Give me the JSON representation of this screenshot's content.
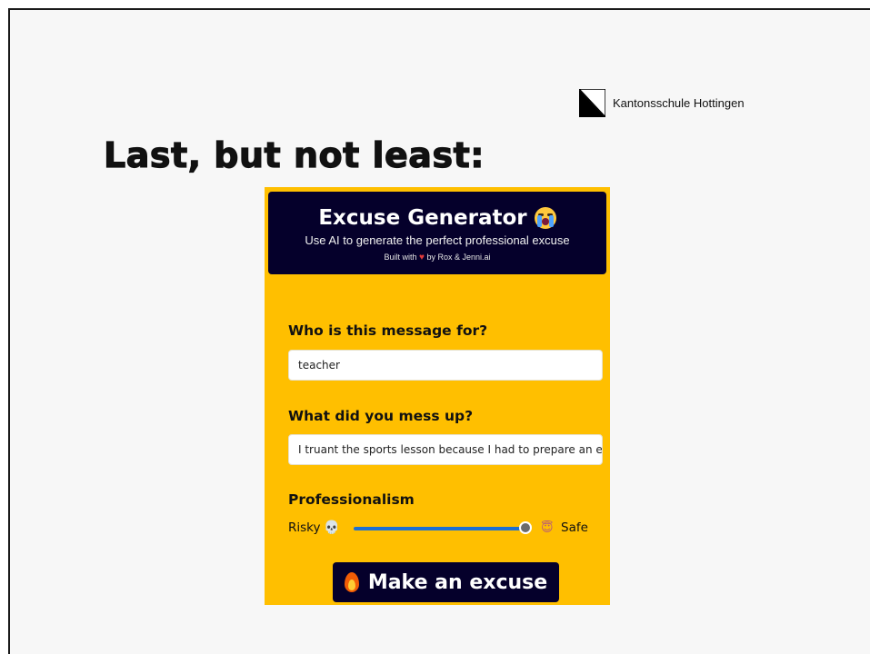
{
  "slide": {
    "school_name": "Kantonsschule Hottingen",
    "title": "Last, but not least:"
  },
  "app": {
    "title": "Excuse Generator",
    "subtitle": "Use AI to generate the perfect professional excuse",
    "credit_prefix": "Built with",
    "credit_heart": "♥",
    "credit_suffix": "by Rox & Jenni.ai",
    "recipient": {
      "label": "Who is this message for?",
      "value": "teacher"
    },
    "mistake": {
      "label": "What did you mess up?",
      "value": "I truant the sports lesson because I had to prepare an exam"
    },
    "professionalism": {
      "label": "Professionalism",
      "min_label": "Risky",
      "max_label": "Safe",
      "min_icon": "skull-icon",
      "max_icon": "angel-face-icon",
      "value": 0.97
    },
    "submit_label": "Make an excuse",
    "colors": {
      "background": "#ffbf00",
      "header": "#05002b",
      "slider_accent": "#1d6fd1"
    }
  }
}
